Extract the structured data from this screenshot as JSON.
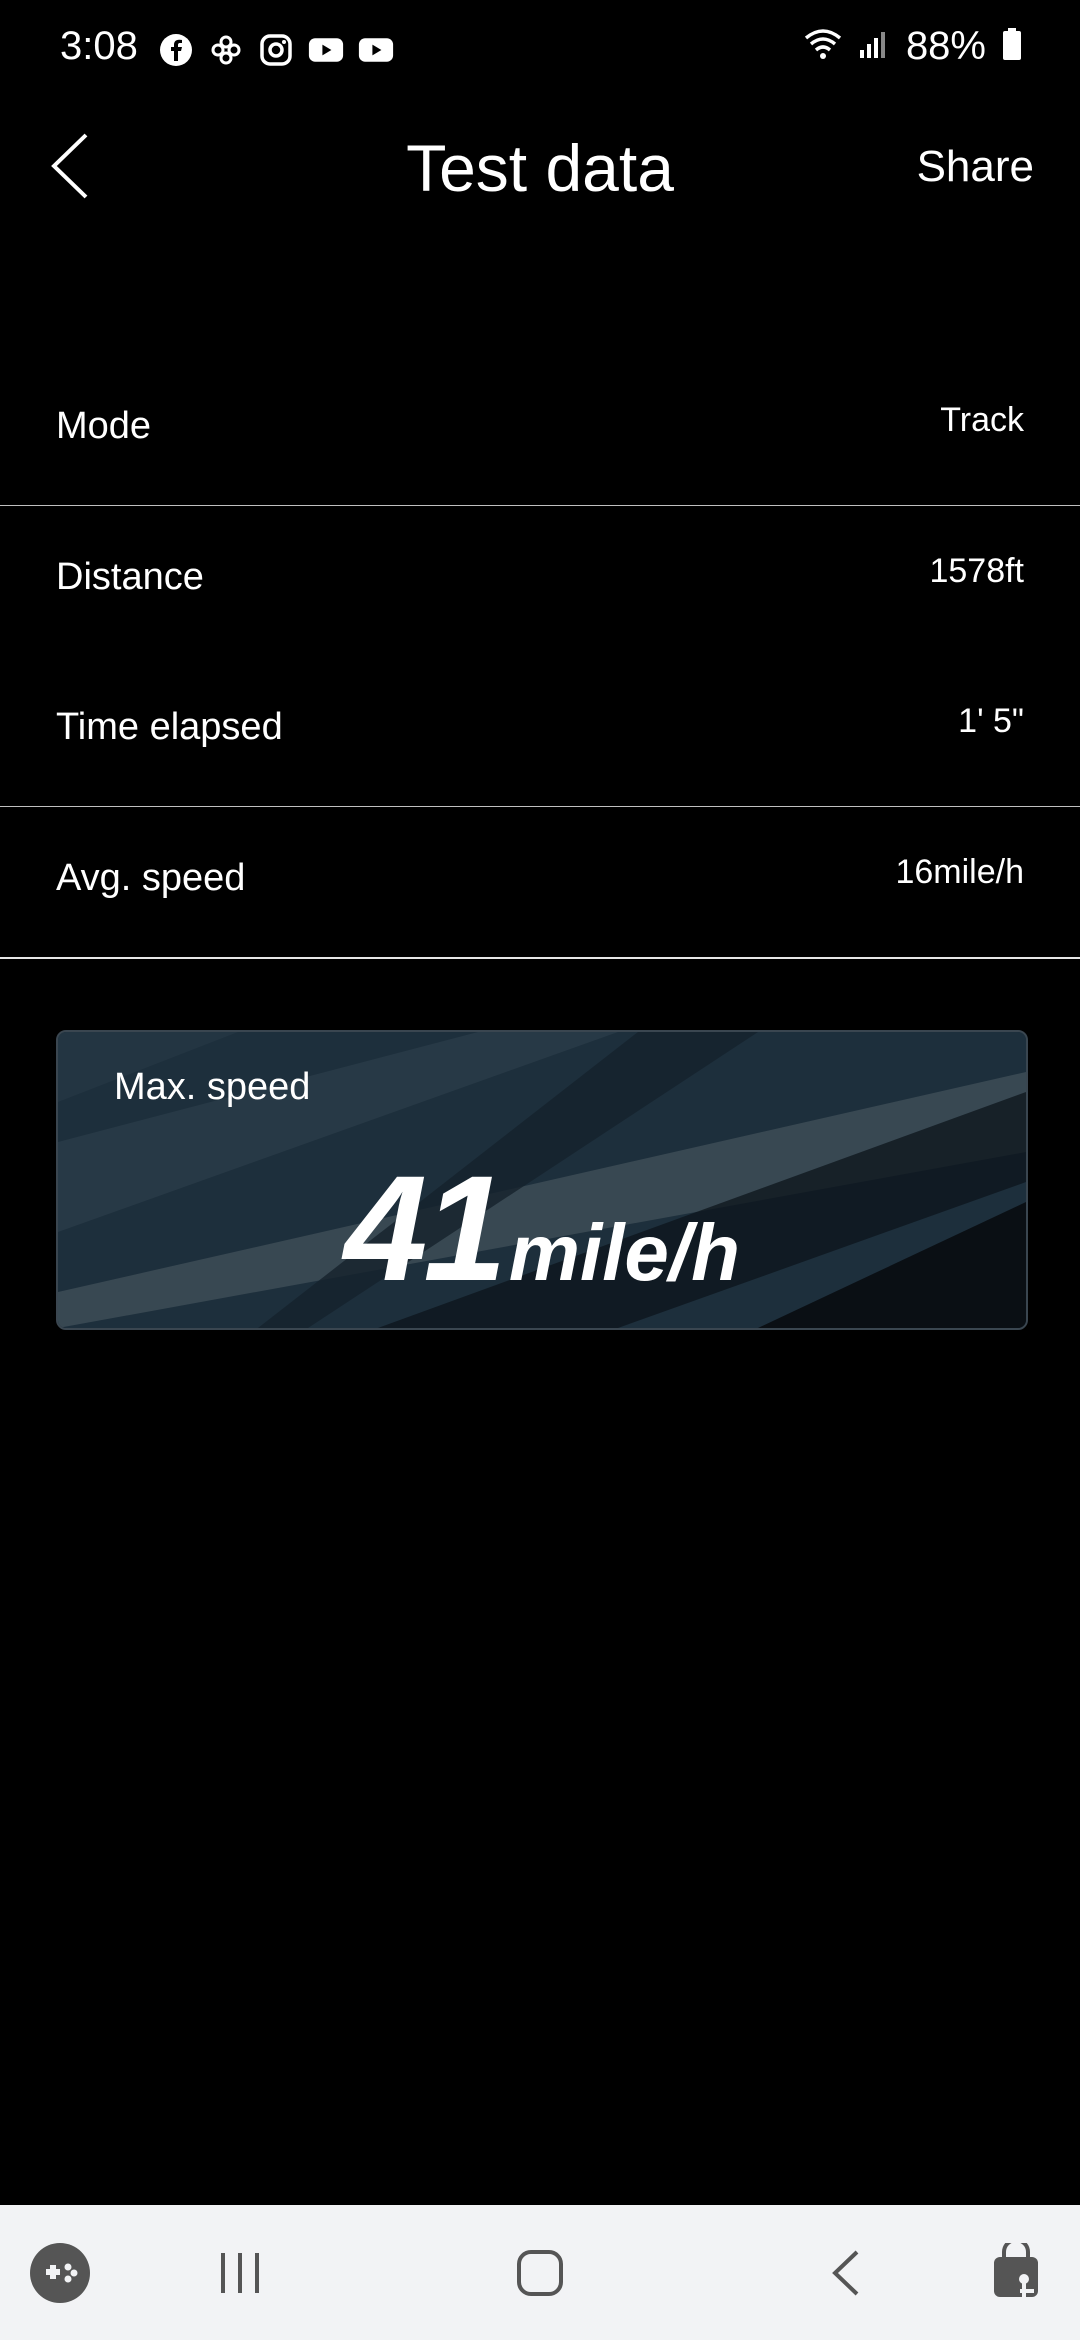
{
  "status_bar": {
    "time": "3:08",
    "battery": "88%",
    "left_icons": [
      "facebook-icon",
      "pinwheel-icon",
      "instagram-icon",
      "youtube-icon",
      "youtube-icon"
    ],
    "right_icons": [
      "wifi-icon",
      "signal-icon",
      "battery-icon"
    ]
  },
  "header": {
    "title": "Test data",
    "share_label": "Share"
  },
  "rows": [
    {
      "label": "Mode",
      "value": "Track"
    },
    {
      "label": "Distance",
      "value": "1578ft"
    },
    {
      "label": "Time elapsed",
      "value": "1' 5\""
    },
    {
      "label": "Avg. speed",
      "value": "16mile/h"
    }
  ],
  "max_speed": {
    "label": "Max. speed",
    "value": "41",
    "unit": "mile/h"
  },
  "colors": {
    "background": "#000000",
    "card": "#1c2c38",
    "navbar": "#f2f3f5"
  }
}
